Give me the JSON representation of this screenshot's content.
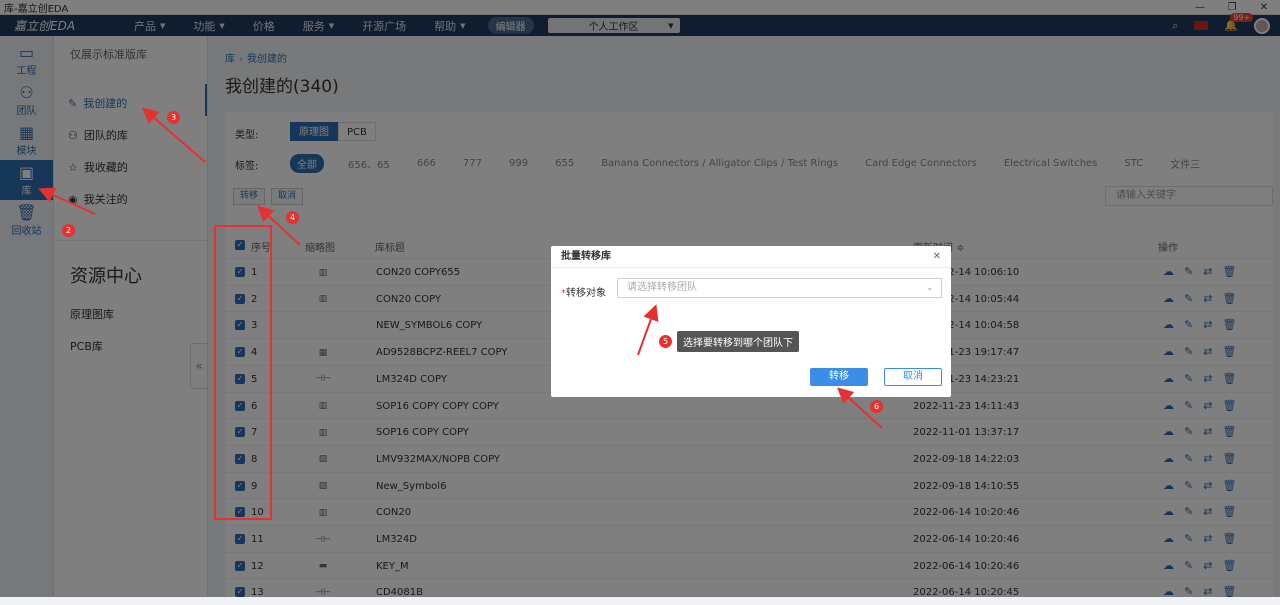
{
  "window": {
    "title": "库-嘉立创EDA",
    "controls": [
      "—",
      "❐",
      "✕"
    ]
  },
  "topnav": {
    "logo": "嘉立创EDA",
    "items": [
      {
        "label": "产品"
      },
      {
        "label": "功能"
      },
      {
        "label": "价格"
      },
      {
        "label": "服务"
      },
      {
        "label": "开源广场"
      },
      {
        "label": "帮助"
      }
    ],
    "editor_label": "编辑器",
    "workspace": "个人工作区",
    "notification_count": "99+"
  },
  "rail": [
    {
      "label": "工程",
      "icon": "folder-icon"
    },
    {
      "label": "团队",
      "icon": "team-icon"
    },
    {
      "label": "模块",
      "icon": "module-icon"
    },
    {
      "label": "库",
      "icon": "chip-icon"
    },
    {
      "label": "回收站",
      "icon": "trash-icon"
    }
  ],
  "sidebar": {
    "note": "仅展示标准版库",
    "items": [
      {
        "label": "我创建的"
      },
      {
        "label": "团队的库"
      },
      {
        "label": "我收藏的"
      },
      {
        "label": "我关注的"
      }
    ],
    "resource_title": "资源中心",
    "resources": [
      "原理图库",
      "PCB库"
    ]
  },
  "main": {
    "breadcrumb": [
      "库",
      "我创建的"
    ],
    "title": "我创建的(340)",
    "type_label": "类型:",
    "types": [
      "原理图",
      "PCB"
    ],
    "tag_label": "标签:",
    "tags": [
      "全部",
      "656、65",
      "666",
      "777",
      "999",
      "655",
      "Banana Connectors / Alligator Clips / Test Rings",
      "Card Edge Connectors",
      "Electrical Switches",
      "STC",
      "文件三"
    ],
    "transfer_label": "转移",
    "cancel_label": "取消",
    "search_placeholder": "请输入关键字",
    "columns": {
      "index": "序号",
      "thumb": "缩略图",
      "name": "库标题",
      "updated": "更新时间 ≑",
      "ops": "操作"
    },
    "rows": [
      {
        "idx": "1",
        "name": "CON20 COPY655",
        "time": "2023-02-14 10:06:10"
      },
      {
        "idx": "2",
        "name": "CON20 COPY",
        "time": "2023-02-14 10:05:44"
      },
      {
        "idx": "3",
        "name": "NEW_SYMBOL6 COPY",
        "time": "2023-02-14 10:04:58"
      },
      {
        "idx": "4",
        "name": "AD9528BCPZ-REEL7 COPY",
        "time": "2022-11-23 19:17:47"
      },
      {
        "idx": "5",
        "name": "LM324D COPY",
        "time": "2022-11-23 14:23:21"
      },
      {
        "idx": "6",
        "name": "SOP16 COPY COPY COPY",
        "time": "2022-11-23 14:11:43"
      },
      {
        "idx": "7",
        "name": "SOP16 COPY COPY",
        "time": "2022-11-01 13:37:17"
      },
      {
        "idx": "8",
        "name": "LMV932MAX/NOPB COPY",
        "time": "2022-09-18 14:22:03"
      },
      {
        "idx": "9",
        "name": "New_Symbol6",
        "time": "2022-09-18 14:10:55"
      },
      {
        "idx": "10",
        "name": "CON20",
        "time": "2022-06-14 10:20:46"
      },
      {
        "idx": "11",
        "name": "LM324D",
        "time": "2022-06-14 10:20:46"
      },
      {
        "idx": "12",
        "name": "KEY_M",
        "time": "2022-06-14 10:20:46"
      },
      {
        "idx": "13",
        "name": "CD4081B",
        "time": "2022-06-14 10:20:45"
      }
    ]
  },
  "modal": {
    "title": "批量转移库",
    "field_label": "转移对象",
    "placeholder": "请选择转移团队",
    "ok_label": "转移",
    "cancel_label": "取消"
  },
  "tooltip": "选择要转移到哪个团队下",
  "steps": [
    "2",
    "3",
    "4",
    "5",
    "6"
  ]
}
